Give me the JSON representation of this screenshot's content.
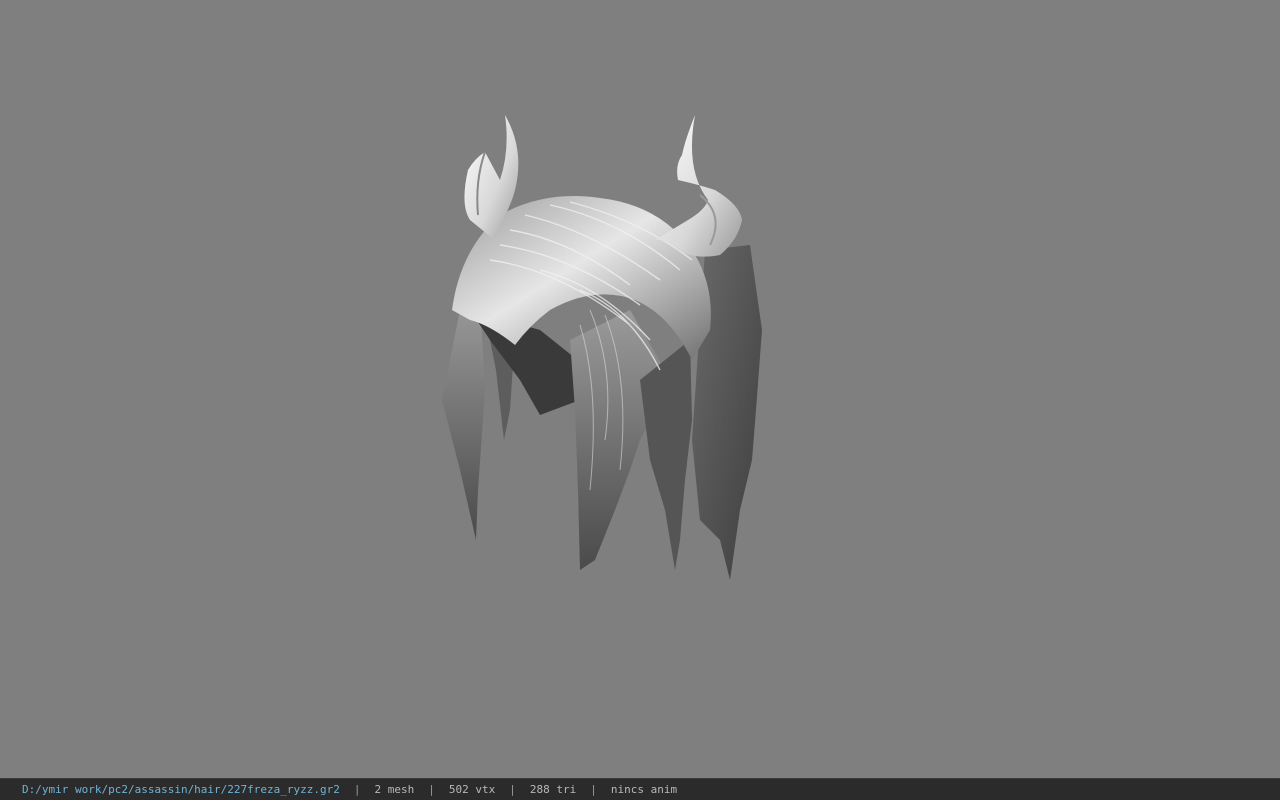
{
  "viewer": {
    "background_color": "#7f7f7f",
    "model_icon": "horned-hair-model"
  },
  "status_bar": {
    "file_path": "D:/ymir work/pc2/assassin/hair/227freza_ryzz.gr2",
    "separator": "|",
    "mesh_count": "2 mesh",
    "vertex_count": "502 vtx",
    "triangle_count": "288 tri",
    "animation": "nincs anim",
    "path_color": "#6fb3d6"
  }
}
